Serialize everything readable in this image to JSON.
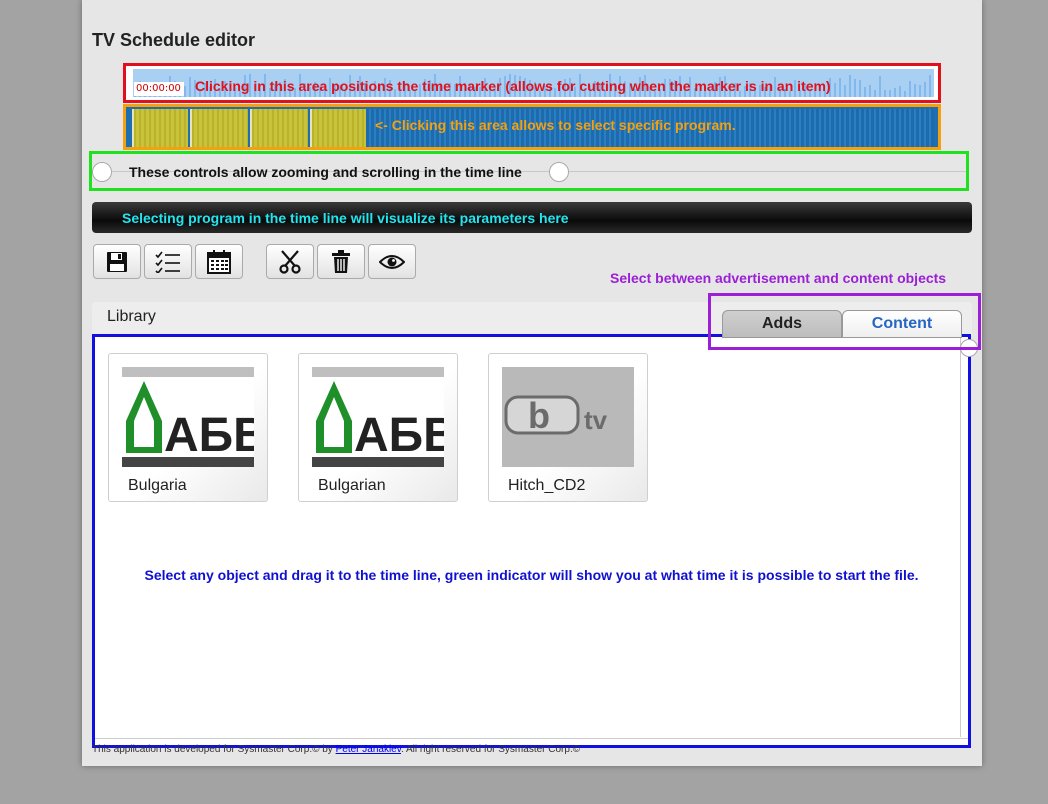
{
  "app": {
    "title": "TV Schedule editor"
  },
  "timeline": {
    "marker_time": "00:00:00",
    "ruler_note": "Clicking in this area positions the time marker (allows for cutting when the marker is in an item)",
    "track_note": "<- Clicking this area allows to select specific program.",
    "zoom_note": "These controls allow zooming and scrolling in the time line"
  },
  "params_bar": {
    "note": "Selecting program in the time line will visualize its parameters here"
  },
  "toolbar": {
    "buttons": [
      {
        "name": "save",
        "icon": "floppy-disk-icon"
      },
      {
        "name": "checklist",
        "icon": "checklist-icon"
      },
      {
        "name": "calendar",
        "icon": "calendar-icon"
      },
      {
        "name": "cut",
        "icon": "scissors-icon"
      },
      {
        "name": "delete",
        "icon": "trash-icon"
      },
      {
        "name": "preview",
        "icon": "eye-icon"
      }
    ]
  },
  "library": {
    "title": "Library",
    "tab_hint": "Select between advertisement and content objects",
    "tabs": [
      {
        "label": "Adds",
        "active": true
      },
      {
        "label": "Content",
        "active": false
      }
    ],
    "items": [
      {
        "label": "Bulgaria",
        "logo_text": "АБВ"
      },
      {
        "label": "Bulgarian",
        "logo_text": "АБВ"
      },
      {
        "label": "Hitch_CD2",
        "logo_text": "tv"
      }
    ],
    "drag_note": "Select any object and drag it to the time line, green indicator will show you at what time it is possible to start the file."
  },
  "footer": {
    "prefix": "This application is developed for Sysmaster Corp.© by",
    "author": "Peter Janakiev",
    "suffix": ". All right reserved for Sysmaster Corp.©"
  },
  "colors": {
    "ruler_border": "#e0101c",
    "track_border": "#f5a00f",
    "zoom_border": "#20e020",
    "params_text": "#22e5f0",
    "tabs_border": "#9b1fd6",
    "library_border": "#1010e0",
    "content_tab_text": "#2566c4"
  }
}
